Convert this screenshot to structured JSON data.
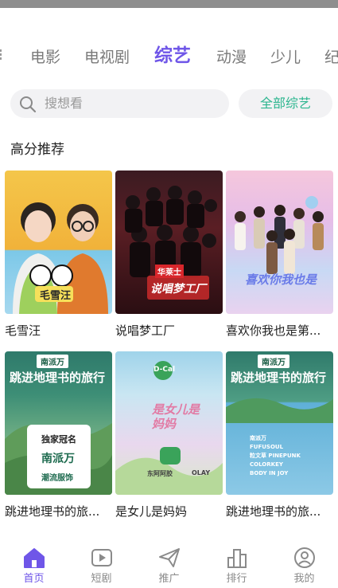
{
  "tabs": [
    {
      "label": "电影",
      "active": false
    },
    {
      "label": "电视剧",
      "active": false
    },
    {
      "label": "综艺",
      "active": true
    },
    {
      "label": "动漫",
      "active": false
    },
    {
      "label": "少儿",
      "active": false
    },
    {
      "label": "纪",
      "active": false
    }
  ],
  "search": {
    "placeholder": "搜想看"
  },
  "all_button": "全部综艺",
  "section_title": "高分推荐",
  "cards": [
    {
      "title": "毛雪汪",
      "poster_text": "毛雪汪"
    },
    {
      "title": "说唱梦工厂",
      "poster_text": "说唱梦工厂",
      "poster_brand": "华莱士"
    },
    {
      "title": "喜欢你我也是第...",
      "poster_text": "喜欢你我也是"
    },
    {
      "title": "跳进地理书的旅...",
      "poster_text": "跳进地理书的旅行",
      "poster_brand": "南派万",
      "poster_badge": "独家冠名",
      "poster_badge2": "南派万",
      "poster_badge3": "潮流服饰"
    },
    {
      "title": "是女儿是妈妈",
      "poster_text": "是女儿是妈妈",
      "poster_brand": "D-Cal",
      "poster_sponsor": "东阿阿胶",
      "poster_sponsor2": "OLAY"
    },
    {
      "title": "跳进地理书的旅...",
      "poster_text": "跳进地理书的旅行",
      "poster_brand": "南派万",
      "poster_list": [
        "南派万",
        "FUFUSOUL",
        "粒文草 PINEPUNK",
        "COLORKEY",
        "BODY IN JOY"
      ]
    }
  ],
  "bottom_nav": [
    {
      "label": "首页",
      "icon": "home-icon",
      "active": true
    },
    {
      "label": "短剧",
      "icon": "play-icon",
      "active": false
    },
    {
      "label": "推广",
      "icon": "send-icon",
      "active": false
    },
    {
      "label": "排行",
      "icon": "rank-icon",
      "active": false
    },
    {
      "label": "我的",
      "icon": "profile-icon",
      "active": false
    }
  ],
  "colors": {
    "accent": "#6f56e8",
    "green": "#2bb58e"
  }
}
